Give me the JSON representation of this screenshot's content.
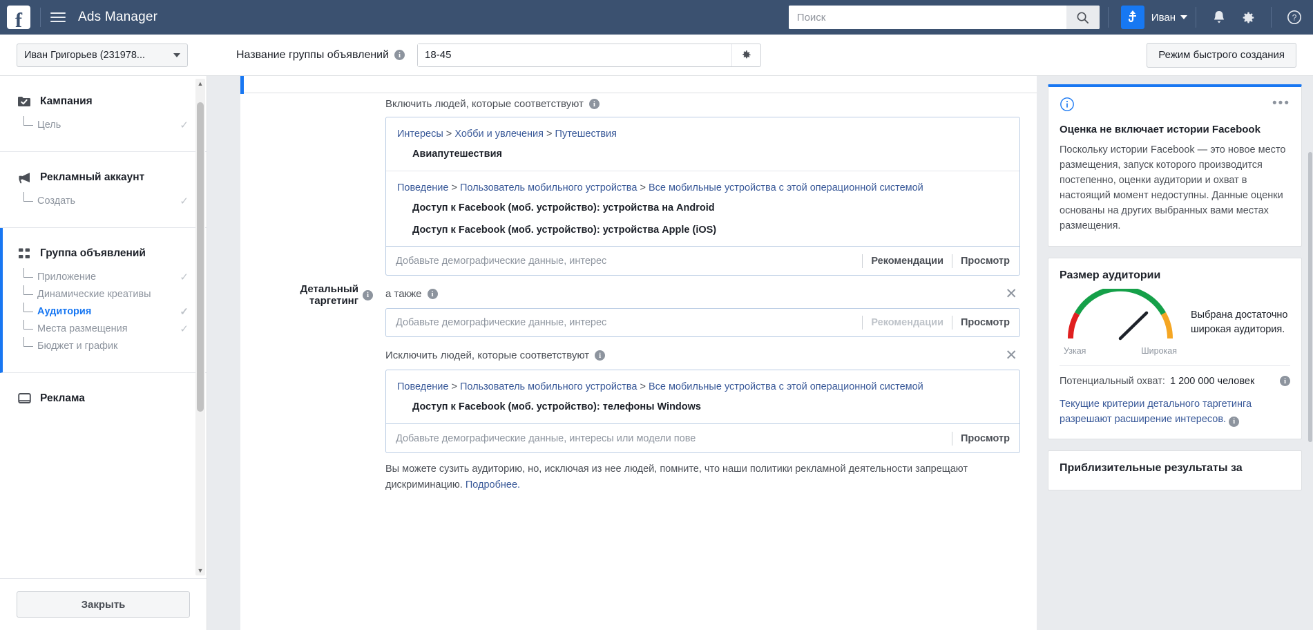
{
  "topbar": {
    "logo": "f",
    "menu_icon": "hamburger-icon",
    "title": "Ads Manager",
    "search": {
      "placeholder": "Поиск",
      "value": "",
      "icon": "search-icon"
    },
    "avatar_letter": "ҍ",
    "user_name": "Иван",
    "notifications_icon": "bell-icon",
    "settings_icon": "gear-icon",
    "help_icon": "question-icon"
  },
  "subbar": {
    "account": "Иван Григорьев (231978...",
    "adset_name_label": "Название группы объявлений",
    "adset_name_value": "18-45",
    "adset_name_placeholder": "Название группы объявлений",
    "gear_icon": "gear-icon",
    "quick_create": "Режим быстрого создания"
  },
  "sidebar": {
    "groups": [
      {
        "icon": "folder-check-icon",
        "title": "Кампания",
        "items": [
          {
            "label": "Цель",
            "checked": true,
            "selected": false
          }
        ]
      },
      {
        "icon": "megaphone-icon",
        "title": "Рекламный аккаунт",
        "items": [
          {
            "label": "Создать",
            "checked": true,
            "selected": false
          }
        ]
      },
      {
        "icon": "grid-icon",
        "title": "Группа объявлений",
        "active": true,
        "items": [
          {
            "label": "Приложение",
            "checked": true,
            "selected": false
          },
          {
            "label": "Динамические креативы",
            "checked": false,
            "selected": false
          },
          {
            "label": "Аудитория",
            "checked": true,
            "selected": true
          },
          {
            "label": "Места размещения",
            "checked": true,
            "selected": false
          },
          {
            "label": "Бюджет и график",
            "checked": false,
            "selected": false
          }
        ]
      },
      {
        "icon": "ad-icon",
        "title": "Реклама",
        "items": []
      }
    ],
    "close_button": "Закрыть"
  },
  "main": {
    "detailed_targeting_label": "Детальный таргетинг",
    "include": {
      "title": "Включить людей, которые соответствуют",
      "sections": [
        {
          "path": [
            "Интересы",
            "Хобби и увлечения",
            "Путешествия"
          ],
          "items": [
            "Авиапутешествия"
          ]
        },
        {
          "path": [
            "Поведение",
            "Пользователь мобильного устройства",
            "Все мобильные устройства с этой операционной системой"
          ],
          "items": [
            "Доступ к Facebook (моб. устройство): устройства на Android",
            "Доступ к Facebook (моб. устройство): устройства Apple (iOS)"
          ]
        }
      ],
      "input_placeholder": "Добавьте демографические данные, интерес",
      "action_recommend": "Рекомендации",
      "action_preview": "Просмотр"
    },
    "also": {
      "title": "а также",
      "input_placeholder": "Добавьте демографические данные, интерес",
      "action_recommend": "Рекомендации",
      "action_preview": "Просмотр",
      "close_icon": "close-icon"
    },
    "exclude": {
      "title": "Исключить людей, которые соответствуют",
      "close_icon": "close-icon",
      "sections": [
        {
          "path": [
            "Поведение",
            "Пользователь мобильного устройства",
            "Все мобильные устройства с этой операционной системой"
          ],
          "items": [
            "Доступ к Facebook (моб. устройство): телефоны Windows"
          ]
        }
      ],
      "input_placeholder": "Добавьте демографические данные, интересы или модели пове",
      "action_preview": "Просмотр"
    },
    "footnote": "Вы можете сузить аудиторию, но, исключая из нее людей, помните, что наши политики рекламной деятельности запрещают дискриминацию.",
    "footnote_link": "Подробнее."
  },
  "rightpanel": {
    "notice": {
      "icon": "info-circle-icon",
      "menu_icon": "more-options-icon",
      "title": "Оценка не включает истории Facebook",
      "text": "Поскольку истории Facebook — это новое место размещения, запуск которого производится постепенно, оценки аудитории и охват в настоящий момент недоступны. Данные оценки основаны на других выбранных вами местах размещения."
    },
    "audience": {
      "title": "Размер аудитории",
      "gauge_low_label": "Узкая",
      "gauge_high_label": "Широкая",
      "message": "Выбрана достаточно широкая аудитория.",
      "reach_label": "Потенциальный охват:",
      "reach_value": "1 200 000 человек",
      "reach_info_icon": "info-icon",
      "note": "Текущие критерии детального таргетинга разрешают расширение интересов.",
      "note_info_icon": "info-icon"
    },
    "results": {
      "title": "Приблизительные результаты за"
    }
  },
  "colors": {
    "brand": "#1877f2",
    "topbar": "#3b5170",
    "link": "#385898",
    "gauge_green": "#15a049",
    "gauge_red": "#e01f1f",
    "gauge_amber": "#f5a623"
  },
  "chart_data": {
    "type": "gauge",
    "title": "Размер аудитории",
    "min_label": "Узкая",
    "max_label": "Широкая",
    "needle_value": 0.68,
    "range": [
      0,
      1
    ],
    "segments": [
      {
        "from": 0.0,
        "to": 0.14,
        "color": "#e01f1f"
      },
      {
        "from": 0.14,
        "to": 0.86,
        "color": "#15a049"
      },
      {
        "from": 0.86,
        "to": 1.0,
        "color": "#f5a623"
      }
    ],
    "annotation": "Выбрана достаточно широкая аудитория."
  }
}
